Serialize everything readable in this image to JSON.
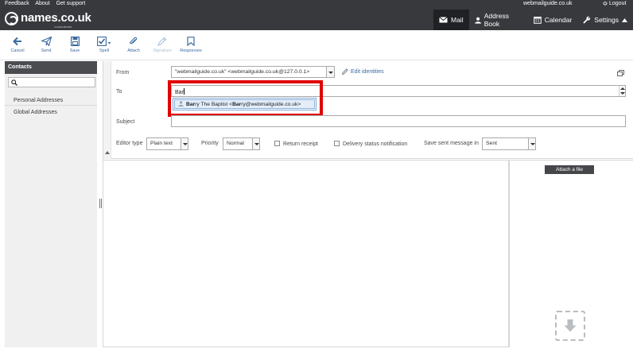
{
  "top_links": [
    "Feedback",
    "About",
    "Get support"
  ],
  "user": {
    "email": "webmailguide.co.uk",
    "logout_label": "Logout"
  },
  "logo": {
    "text": "names.co.uk",
    "tagline": "A DADA BRAND"
  },
  "main_nav": [
    {
      "label": "Mail",
      "icon": "envelope-icon",
      "active": true
    },
    {
      "label": "Address Book",
      "icon": "person-icon",
      "active": false
    },
    {
      "label": "Calendar",
      "icon": "calendar-icon",
      "active": false
    },
    {
      "label": "Settings",
      "icon": "wrench-icon",
      "active": false
    }
  ],
  "toolbar": {
    "cancel": "Cancel",
    "send": "Send",
    "save": "Save",
    "spell": "Spell",
    "attach": "Attach",
    "signature": "Signature",
    "responses": "Responses"
  },
  "sidebar": {
    "header": "Contacts",
    "search_value": "",
    "items": [
      "Personal Addresses",
      "Global Addresses"
    ]
  },
  "compose": {
    "from_label": "From",
    "from_value": "\"webmailguide.co.uk\" <webmailguide.co.uk@127.0.0.1>",
    "edit_identities": "Edit identities",
    "to_label": "To",
    "to_value": "Bar",
    "autocomplete": {
      "match": "Bar",
      "rest_name": "ry The Baptist <",
      "match2": "Bar",
      "rest_email": "ry@webmailguide.co.uk>"
    },
    "subject_label": "Subject",
    "subject_value": "",
    "editor_type_label": "Editor type",
    "editor_type_value": "Plain text",
    "priority_label": "Priority",
    "priority_value": "Normal",
    "return_receipt_label": "Return receipt",
    "delivery_status_label": "Delivery status notification",
    "save_sent_label": "Save sent message in",
    "save_sent_value": "Sent",
    "attach_file_label": "Attach a file"
  },
  "colors": {
    "topbar": "#37393d",
    "accent_link": "#3b6ba0",
    "highlight": "#e00000"
  }
}
